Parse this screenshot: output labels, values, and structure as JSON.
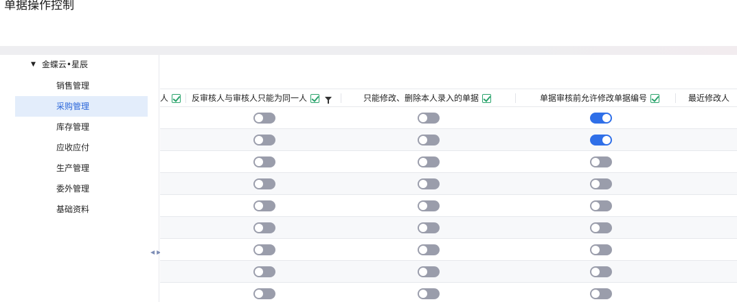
{
  "page": {
    "title": "单据操作控制"
  },
  "tree": {
    "root": "金蝶云•星辰",
    "items": [
      {
        "label": "销售管理",
        "selected": false
      },
      {
        "label": "采购管理",
        "selected": true
      },
      {
        "label": "库存管理",
        "selected": false
      },
      {
        "label": "应收应付",
        "selected": false
      },
      {
        "label": "生产管理",
        "selected": false
      },
      {
        "label": "委外管理",
        "selected": false
      },
      {
        "label": "基础资料",
        "selected": false
      }
    ]
  },
  "grid": {
    "columns": [
      {
        "label": "人",
        "checkbox": true
      },
      {
        "label": "反审核人与审核人只能为同一人",
        "checkbox": true,
        "filter": true
      },
      {
        "label": "只能修改、删除本人录入的单据",
        "checkbox": true
      },
      {
        "label": "单据审核前允许修改单据编号",
        "checkbox": true
      },
      {
        "label": "最近修改人",
        "checkbox": false
      }
    ],
    "rows": [
      {
        "reverse_audit_same": false,
        "own_docs_only": false,
        "edit_number_before_audit": true
      },
      {
        "reverse_audit_same": false,
        "own_docs_only": false,
        "edit_number_before_audit": true
      },
      {
        "reverse_audit_same": false,
        "own_docs_only": false,
        "edit_number_before_audit": false
      },
      {
        "reverse_audit_same": false,
        "own_docs_only": false,
        "edit_number_before_audit": false
      },
      {
        "reverse_audit_same": false,
        "own_docs_only": false,
        "edit_number_before_audit": false
      },
      {
        "reverse_audit_same": false,
        "own_docs_only": false,
        "edit_number_before_audit": false
      },
      {
        "reverse_audit_same": false,
        "own_docs_only": false,
        "edit_number_before_audit": false
      },
      {
        "reverse_audit_same": false,
        "own_docs_only": false,
        "edit_number_before_audit": false
      },
      {
        "reverse_audit_same": false,
        "own_docs_only": false,
        "edit_number_before_audit": false
      }
    ]
  },
  "colors": {
    "toggle_on": "#2f6fe8",
    "toggle_off": "#9a9dab",
    "selected_bg": "#e3edfb",
    "checkbox": "#29a36b"
  }
}
